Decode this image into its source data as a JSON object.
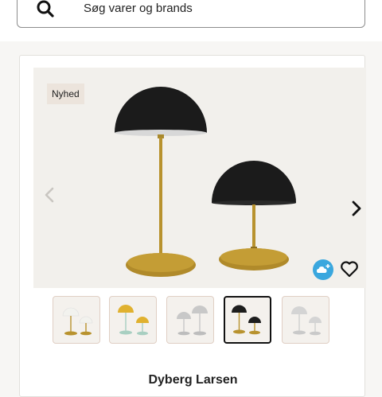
{
  "search": {
    "placeholder": "Søg varer og brands",
    "icon": "search-icon"
  },
  "product": {
    "badge": "Nyhed",
    "brand": "Dyberg Larsen",
    "image_description_icon": "table-lamp-pair",
    "favorite_icon": "heart-icon",
    "cloud_icon": "cloud-plus-icon",
    "thumbnails": [
      {
        "variant": "white",
        "shade_color": "#f2f2ee",
        "base_color": "#b8922e"
      },
      {
        "variant": "yellow",
        "shade_color": "#e0b12f",
        "base_color": "#a8cfc1"
      },
      {
        "variant": "silver",
        "shade_color": "#c8c8c8",
        "base_color": "#c8c8c8"
      },
      {
        "variant": "black",
        "shade_color": "#1d1d1d",
        "base_color": "#b8922e",
        "selected": true
      },
      {
        "variant": "silver-light",
        "shade_color": "#d4d4d4",
        "base_color": "#d4d4d4"
      }
    ]
  },
  "colors": {
    "brass": "#b8922e",
    "shade_black": "#1b1b1b",
    "cloud_blue": "#3aa7de"
  }
}
